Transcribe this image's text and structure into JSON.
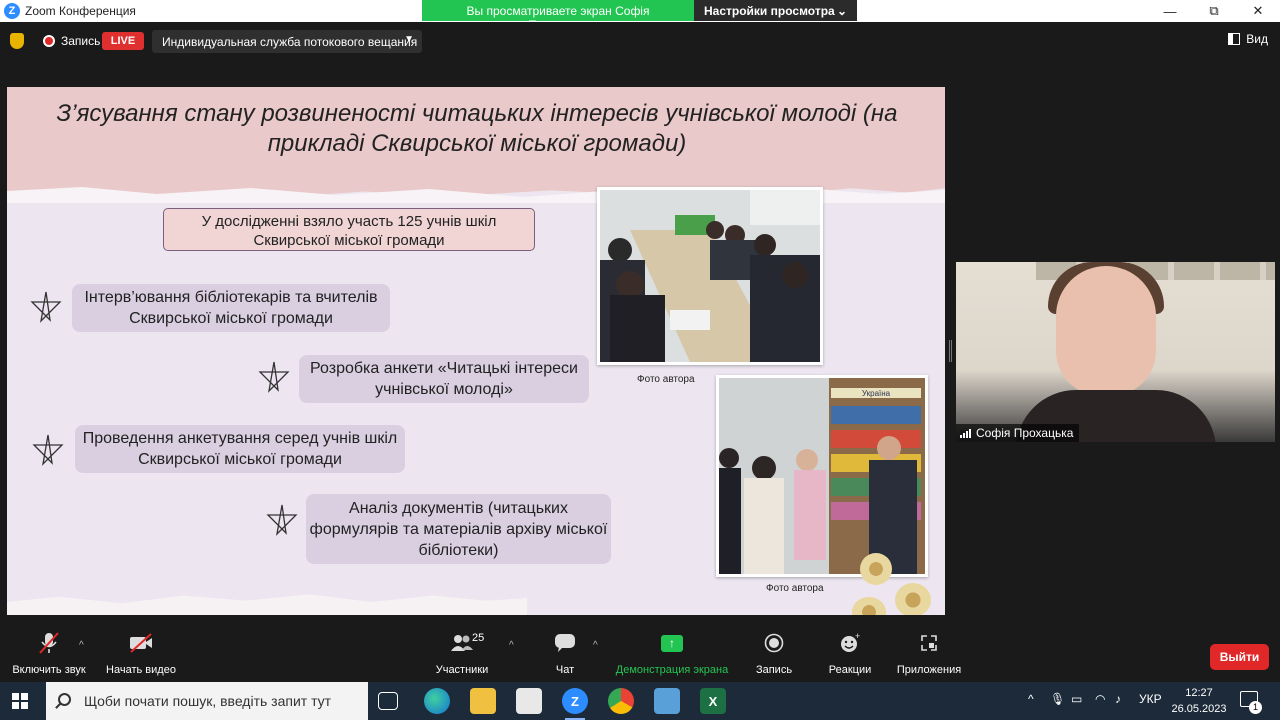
{
  "window": {
    "app_title": "Zoom Конференция",
    "share_banner": "Вы просматриваете экран Софія Прохацька",
    "view_settings": "Настройки просмотра",
    "minimize": "—",
    "maximize": "⧉",
    "close": "✕"
  },
  "topbar": {
    "record_label": "Запись",
    "live_badge": "LIVE",
    "stream_service": "Индивидуальная служба потокового вещания",
    "view_label": "Вид"
  },
  "slide": {
    "title": "З’ясування стану розвиненості читацьких інтересів учнівської молоді (на прикладі Сквирської міської громади)",
    "intro": "У дослідженні взяло участь 125 учнів шкіл Сквирської міської громади",
    "items": [
      "Інтерв’ювання бібліотекарів та вчителів Сквирської міської громади",
      "Розробка анкети «Читацькі інтереси учнівської молоді»",
      "Проведення анкетування серед учнів шкіл Сквирської міської громади",
      "Аналіз документів (читацьких формулярів та матеріалів архіву міської бібліотеки)"
    ],
    "photo_caption_1": "Фото автора",
    "photo_caption_2": "Фото автора",
    "shelf_sign": "Україна"
  },
  "participant": {
    "name": "Софія Прохацька"
  },
  "toolbar": {
    "unmute": "Включить звук",
    "start_video": "Начать видео",
    "participants": "Участники",
    "participants_count": "25",
    "chat": "Чат",
    "share_screen": "Демонстрация экрана",
    "record": "Запись",
    "reactions": "Реакции",
    "apps": "Приложения",
    "leave": "Выйти"
  },
  "taskbar": {
    "search_placeholder": "Щоби почати пошук, введіть запит тут",
    "language": "УКР",
    "time": "12:27",
    "date": "26.05.2023",
    "notifications": "1"
  },
  "colors": {
    "zoom_blue": "#2d8cff",
    "share_green": "#23c552",
    "live_red": "#e02f2f",
    "leave_red": "#e02828"
  }
}
